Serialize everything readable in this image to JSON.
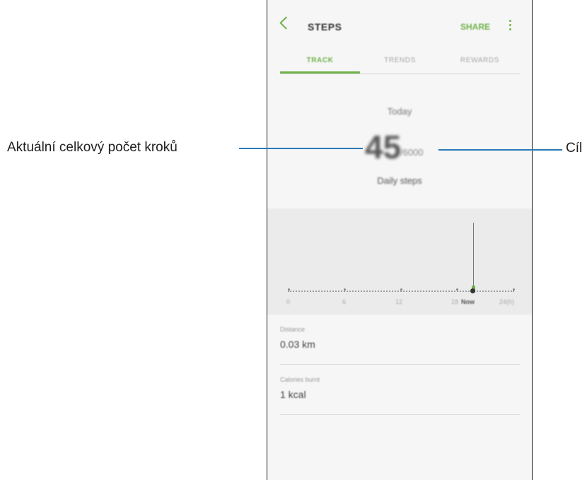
{
  "appbar": {
    "title": "STEPS",
    "share_label": "SHARE"
  },
  "tabs": [
    {
      "label": "TRACK",
      "active": true
    },
    {
      "label": "TRENDS",
      "active": false
    },
    {
      "label": "REWARDS",
      "active": false
    }
  ],
  "summary": {
    "period": "Today",
    "steps": "45",
    "goal": "/6000",
    "caption": "Daily steps"
  },
  "timeline": {
    "labels": [
      "0",
      "6",
      "12",
      "18",
      "Now",
      "24(h)"
    ]
  },
  "stats": [
    {
      "label": "Distance",
      "value": "0.03 km"
    },
    {
      "label": "Calories burnt",
      "value": "1 kcal"
    }
  ],
  "callouts": {
    "left": "Aktuální celkový počet kroků",
    "right": "Cíl"
  },
  "colors": {
    "accent": "#6fb24a",
    "leader": "#2b79b8"
  }
}
